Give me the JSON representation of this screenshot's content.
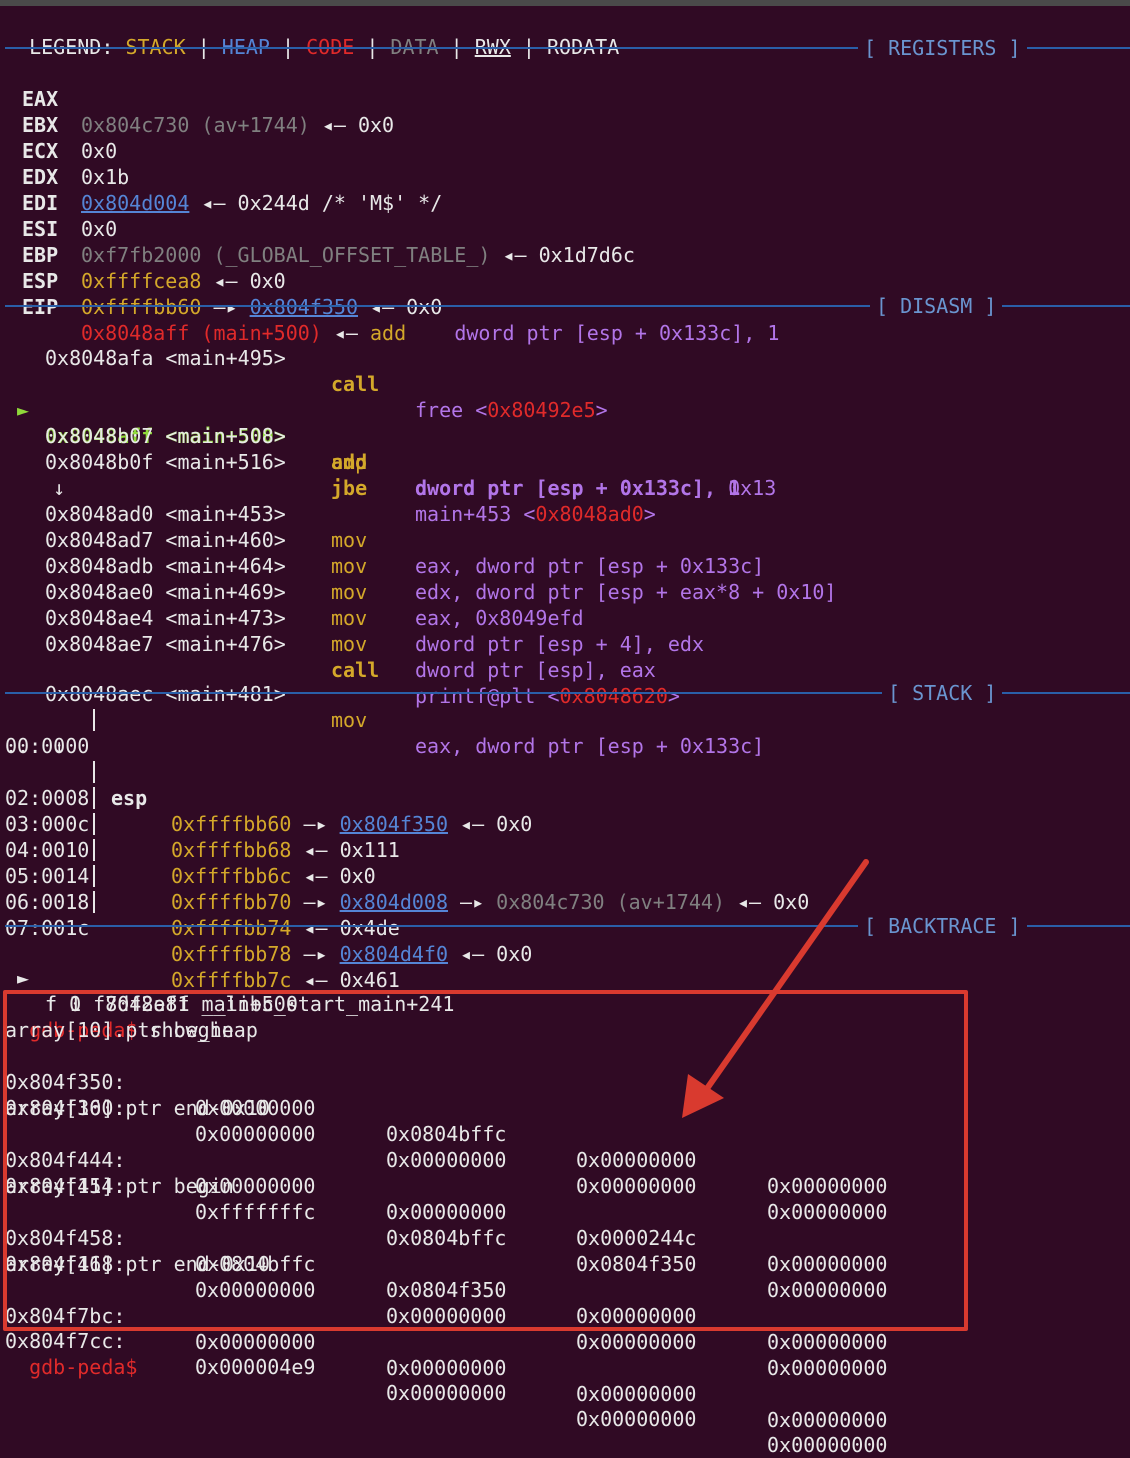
{
  "legend": {
    "prefix": "LEGEND:",
    "stack": "STACK",
    "heap": "HEAP",
    "code": "CODE",
    "data": "DATA",
    "rwx": "RWX",
    "rodata": "RODATA",
    "sep": "|"
  },
  "sections": {
    "registers": "[ REGISTERS ]",
    "disasm": "[ DISASM ]",
    "stack": "[ STACK ]",
    "backtrace": "[ BACKTRACE ]"
  },
  "registers": [
    {
      "name": "EAX",
      "v1": "0x804c730 (av+1744)",
      "v2": "◂— 0x0"
    },
    {
      "name": "EBX",
      "v1": "0x0"
    },
    {
      "name": "ECX",
      "v1": "0x1b"
    },
    {
      "name": "EDX",
      "v1": "0x804d004",
      "v2": "◂— 0x244d /* 'M$' */"
    },
    {
      "name": "EDI",
      "v1": "0x0"
    },
    {
      "name": "ESI",
      "v1": "0xf7fb2000 (_GLOBAL_OFFSET_TABLE_)",
      "v2": "◂— 0x1d7d6c"
    },
    {
      "name": "EBP",
      "v1": "0xffffcea8",
      "v2": "◂— 0x0"
    },
    {
      "name": "ESP",
      "v1": "0xffffbb60",
      "arrow": "—▸",
      "v2": "0x804f350",
      "v3": "◂— 0x0"
    },
    {
      "name": "EIP",
      "v1": "0x8048aff (main+500)",
      "v2": "◂—",
      "op": "add",
      "args": "dword ptr [esp + 0x133c], 1"
    }
  ],
  "disasm": [
    {
      "addr": "0x8048afa <main+495>",
      "op": "call",
      "a1": "free <",
      "a2": "0x80492e5",
      "a3": ">"
    },
    {
      "addr": "0x8048aff <main+500>",
      "op": "add",
      "a1": "dword ptr [esp + 0x133c], 1",
      "marker": "►"
    },
    {
      "addr": "0x8048b07 <main+508>",
      "op": "cmp",
      "a1": "dword ptr [esp + 0x133c], 0x13"
    },
    {
      "addr": "0x8048b0f <main+516>",
      "op": "jbe",
      "a1": "main+453 <",
      "a2": "0x8048ad0",
      "a3": ">"
    },
    {
      "down": "↓"
    },
    {
      "addr": "0x8048ad0 <main+453>",
      "op": "mov",
      "a1": "eax, dword ptr [esp + 0x133c]"
    },
    {
      "addr": "0x8048ad7 <main+460>",
      "op": "mov",
      "a1": "edx, dword ptr [esp + eax*8 + 0x10]"
    },
    {
      "addr": "0x8048adb <main+464>",
      "op": "mov",
      "a1": "eax, 0x8049efd"
    },
    {
      "addr": "0x8048ae0 <main+469>",
      "op": "mov",
      "a1": "dword ptr [esp + 4], edx"
    },
    {
      "addr": "0x8048ae4 <main+473>",
      "op": "mov",
      "a1": "dword ptr [esp], eax"
    },
    {
      "addr": "0x8048ae7 <main+476>",
      "op": "call",
      "a1": "printf@plt <",
      "a2": "0x8048620",
      "a3": ">"
    },
    {
      "addr": "0x8048aec <main+481>",
      "op": "mov",
      "a1": "eax, dword ptr [esp + 0x133c]"
    }
  ],
  "stack": [
    {
      "off": "00:0000",
      "reg": "esp",
      "addr": "0xffffbb60",
      "arrow": "—▸",
      "ptr": "0x804f350",
      "tail": "◂— 0x0"
    },
    {
      "dots": "... ↓"
    },
    {
      "off": "02:0008",
      "addr": "0xffffbb68",
      "tail": "◂— 0x111"
    },
    {
      "off": "03:000c",
      "addr": "0xffffbb6c",
      "tail": "◂— 0x0"
    },
    {
      "off": "04:0010",
      "addr": "0xffffbb70",
      "arrow": "—▸",
      "ptr": "0x804d008",
      "arrow2": "—▸",
      "ptr2": "0x804c730 (av+1744)",
      "tail": "◂— 0x0"
    },
    {
      "off": "05:0014",
      "addr": "0xffffbb74",
      "tail": "◂— 0x4de"
    },
    {
      "off": "06:0018",
      "addr": "0xffffbb78",
      "arrow": "—▸",
      "ptr": "0x804d4f0",
      "tail": "◂— 0x0"
    },
    {
      "off": "07:001c",
      "addr": "0xffffbb7c",
      "tail": "◂— 0x461"
    }
  ],
  "backtrace": [
    {
      "marker": "►",
      "text": "f 0  8048aff main+500"
    },
    {
      "text": "f 1 f7df2e81 __libc_start_main+241"
    }
  ],
  "heap": {
    "prompt": "gdb-peda$",
    "command": "show_heap",
    "lines": [
      {
        "label": "array[10].ptr begin"
      },
      {
        "addr": "0x804f350:",
        "c": [
          "0x00000000",
          "0x0804bffc",
          "0x00000000",
          "0x00000000"
        ]
      },
      {
        "addr": "0x804f360:",
        "c": [
          "0x00000000",
          "0x00000000",
          "0x00000000",
          "0x00000000"
        ]
      },
      {
        "label": "array[10].ptr end-0x10"
      },
      {
        "addr": "0x804f444:",
        "c": [
          "0x00000000",
          "0x00000000",
          "0x0000244c",
          "0x00000000"
        ]
      },
      {
        "addr": "0x804f454:",
        "c": [
          "0xfffffffc",
          "0x0804bffc",
          "0x0804f350",
          "0x00000000"
        ]
      },
      {
        "label": "array[11].ptr begin"
      },
      {
        "addr": "0x804f458:",
        "c": [
          "0x0804bffc",
          "0x0804f350",
          "0x00000000",
          "0x00000000"
        ]
      },
      {
        "addr": "0x804f468:",
        "c": [
          "0x00000000",
          "0x00000000",
          "0x00000000",
          "0x00000000"
        ]
      },
      {
        "label": "array[11].ptr end-0x10"
      },
      {
        "addr": "0x804f7bc:",
        "c": [
          "0x00000000",
          "0x00000000",
          "0x00000000",
          "0x00000000"
        ]
      },
      {
        "addr": "0x804f7cc:",
        "c": [
          "0x000004e9",
          "0x00000000",
          "0x00000000",
          "0x00000000"
        ]
      }
    ],
    "final_prompt": "gdb-peda$"
  },
  "colors": {
    "background": "#300a24",
    "annotation": "#d93a2f",
    "separator": "#2a5fa8"
  }
}
